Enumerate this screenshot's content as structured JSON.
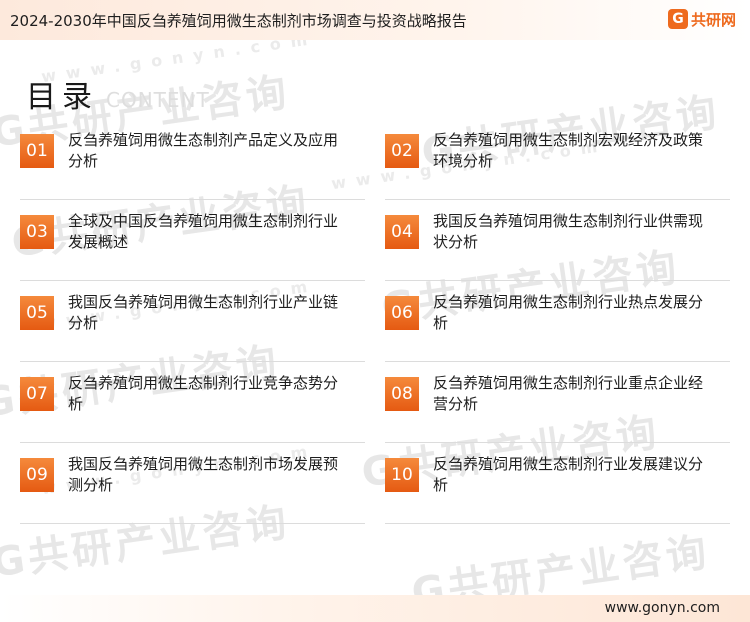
{
  "header": {
    "title": "2024-2030年中国反刍养殖饲用微生态制剂市场调查与投资战略报告",
    "logo_mark": "G",
    "logo_text": "共研网"
  },
  "heading": {
    "title": "目录",
    "subtitle": "CONTENT"
  },
  "toc": [
    {
      "num": "01",
      "label": "反刍养殖饲用微生态制剂产品定义及应用分析"
    },
    {
      "num": "02",
      "label": "反刍养殖饲用微生态制剂宏观经济及政策环境分析"
    },
    {
      "num": "03",
      "label": "全球及中国反刍养殖饲用微生态制剂行业发展概述"
    },
    {
      "num": "04",
      "label": "我国反刍养殖饲用微生态制剂行业供需现状分析"
    },
    {
      "num": "05",
      "label": "我国反刍养殖饲用微生态制剂行业产业链分析"
    },
    {
      "num": "06",
      "label": "反刍养殖饲用微生态制剂行业热点发展分析"
    },
    {
      "num": "07",
      "label": "反刍养殖饲用微生态制剂行业竞争态势分析"
    },
    {
      "num": "08",
      "label": "反刍养殖饲用微生态制剂行业重点企业经营分析"
    },
    {
      "num": "09",
      "label": "我国反刍养殖饲用微生态制剂市场发展预测分析"
    },
    {
      "num": "10",
      "label": "反刍养殖饲用微生态制剂行业发展建议分析"
    }
  ],
  "watermark": {
    "brand": "G共研产业咨询",
    "url": "www.gonyn.com"
  },
  "footer": {
    "url": "www.gonyn.com"
  },
  "colors": {
    "accent": "#ee6a1e",
    "number_box": "#f07a2c"
  }
}
